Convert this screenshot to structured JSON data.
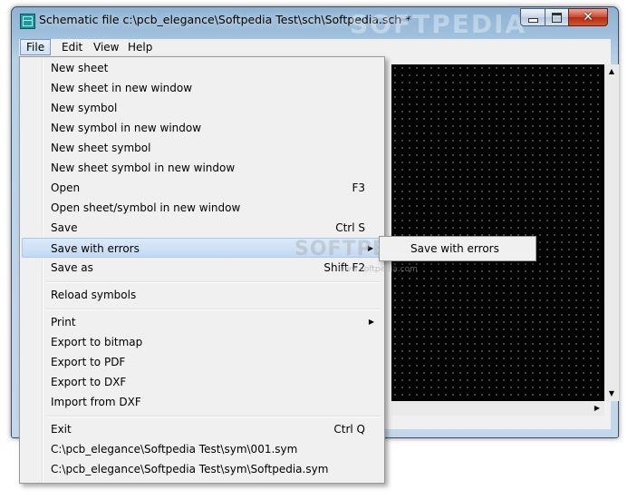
{
  "window": {
    "title": "Schematic file c:\\pcb_elegance\\Softpedia Test\\sch\\Softpedia.sch *",
    "watermark": "SOFTPEDIA",
    "watermark_url": "www.softpedia.com"
  },
  "menubar": {
    "items": [
      {
        "label": "File"
      },
      {
        "label": "Edit"
      },
      {
        "label": "View"
      },
      {
        "label": "Help"
      }
    ]
  },
  "file_menu": {
    "items": [
      {
        "label": "New sheet",
        "shortcut": ""
      },
      {
        "label": "New sheet in new window",
        "shortcut": ""
      },
      {
        "label": "New symbol",
        "shortcut": ""
      },
      {
        "label": "New symbol in new window",
        "shortcut": ""
      },
      {
        "label": "New sheet symbol",
        "shortcut": ""
      },
      {
        "label": "New sheet symbol in new window",
        "shortcut": ""
      },
      {
        "label": "Open",
        "shortcut": "F3"
      },
      {
        "label": "Open sheet/symbol in new window",
        "shortcut": ""
      },
      {
        "label": "Save",
        "shortcut": "Ctrl S"
      },
      {
        "label": "Save with errors",
        "shortcut": ""
      },
      {
        "label": "Save as",
        "shortcut": "Shift F2"
      },
      {
        "label": "Reload symbols",
        "shortcut": ""
      },
      {
        "label": "Print",
        "shortcut": ""
      },
      {
        "label": "Export to bitmap",
        "shortcut": ""
      },
      {
        "label": "Export to PDF",
        "shortcut": ""
      },
      {
        "label": "Export to DXF",
        "shortcut": ""
      },
      {
        "label": "Import from DXF",
        "shortcut": ""
      },
      {
        "label": "Exit",
        "shortcut": "Ctrl Q"
      },
      {
        "label": "C:\\pcb_elegance\\Softpedia Test\\sym\\001.sym",
        "shortcut": ""
      },
      {
        "label": "C:\\pcb_elegance\\Softpedia Test\\sym\\Softpedia.sym",
        "shortcut": ""
      }
    ]
  },
  "submenu": {
    "items": [
      {
        "label": "Save with errors"
      }
    ]
  }
}
